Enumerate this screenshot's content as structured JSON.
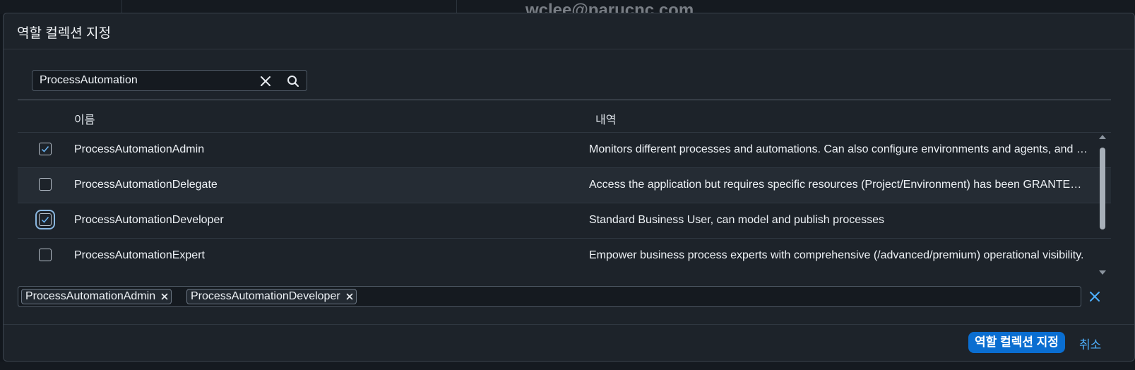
{
  "background": {
    "email": "wclee@parucnc.com"
  },
  "dialog": {
    "title": "역할 컬렉션 지정",
    "search": {
      "value": "ProcessAutomation"
    },
    "table": {
      "columns": {
        "name": "이름",
        "description": "내역"
      },
      "rows": [
        {
          "name": "ProcessAutomationAdmin",
          "description": "Monitors different processes and automations. Can also configure environments and agents, and manage roles and permissions for users.",
          "selected": true
        },
        {
          "name": "ProcessAutomationDelegate",
          "description": "Access the application but requires specific resources (Project/Environment) has been GRANTED to the user.",
          "selected": false
        },
        {
          "name": "ProcessAutomationDeveloper",
          "description": "Standard Business User, can model and publish processes",
          "selected": true
        },
        {
          "name": "ProcessAutomationExpert",
          "description": "Empower business process experts with comprehensive (/advanced/premium) operational visibility.",
          "selected": false
        }
      ]
    },
    "tokens": [
      "ProcessAutomationAdmin",
      "ProcessAutomationDeveloper"
    ],
    "footer": {
      "assign_label": "역할 컬렉션 지정",
      "cancel_label": "취소"
    }
  },
  "colors": {
    "accent": "#0a6ed1",
    "link": "#4db1ff",
    "background": "#1d232a"
  }
}
